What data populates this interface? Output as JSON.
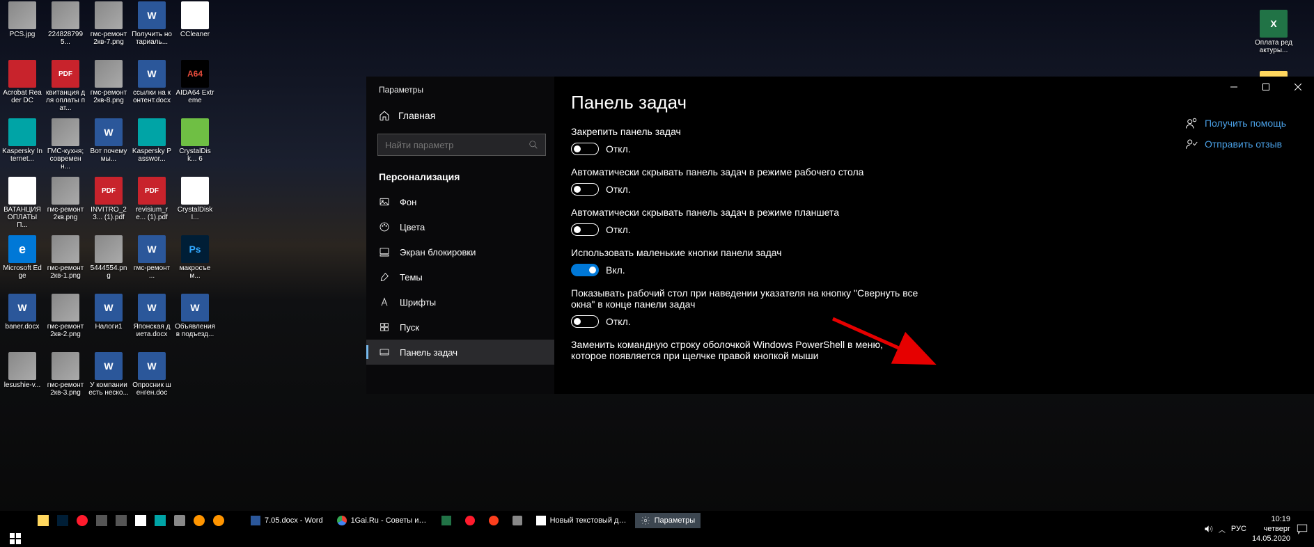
{
  "desktop_icons": [
    {
      "label": "PCS.jpg",
      "type": "img",
      "col": 0,
      "row": 0
    },
    {
      "label": "Acrobat Reader DC",
      "type": "adobe",
      "col": 0,
      "row": 1
    },
    {
      "label": "Kaspersky Internet...",
      "type": "teal",
      "col": 0,
      "row": 2
    },
    {
      "label": "ВАТАНЦИЯ ОПЛАТЫ П...",
      "type": "txt",
      "col": 0,
      "row": 3
    },
    {
      "label": "Microsoft Edge",
      "type": "edge",
      "col": 0,
      "row": 4
    },
    {
      "label": "baner.docx",
      "type": "word",
      "col": 0,
      "row": 5
    },
    {
      "label": "lesushie-v...",
      "type": "img",
      "col": 0,
      "row": 6
    },
    {
      "label": "2248287995...",
      "type": "img",
      "col": 1,
      "row": 0
    },
    {
      "label": "квитанция для оплаты пат...",
      "type": "pdf",
      "col": 1,
      "row": 1
    },
    {
      "label": "ГМС-кухня; современн...",
      "type": "img",
      "col": 1,
      "row": 2
    },
    {
      "label": "гмс-ремонт 2кв.png",
      "type": "img",
      "col": 1,
      "row": 3
    },
    {
      "label": "гмс-ремонт 2кв-1.png",
      "type": "img",
      "col": 1,
      "row": 4
    },
    {
      "label": "гмс-ремонт 2кв-2.png",
      "type": "img",
      "col": 1,
      "row": 5
    },
    {
      "label": "гмс-ремонт 2кв-3.png",
      "type": "img",
      "col": 1,
      "row": 6
    },
    {
      "label": "гмс-ремонт 2кв-7.png",
      "type": "img",
      "col": 2,
      "row": 0
    },
    {
      "label": "гмс-ремонт 2кв-8.png",
      "type": "img",
      "col": 2,
      "row": 1
    },
    {
      "label": "Вот почему мы...",
      "type": "word",
      "col": 2,
      "row": 2
    },
    {
      "label": "INVITRO_23... (1).pdf",
      "type": "pdf",
      "col": 2,
      "row": 3
    },
    {
      "label": "5444554.png",
      "type": "img",
      "col": 2,
      "row": 4
    },
    {
      "label": "Налоги1",
      "type": "word",
      "col": 2,
      "row": 5
    },
    {
      "label": "У компании есть неско...",
      "type": "word",
      "col": 2,
      "row": 6
    },
    {
      "label": "Получить нотариаль...",
      "type": "word",
      "col": 3,
      "row": 0
    },
    {
      "label": "ссылки на контент.docx",
      "type": "word",
      "col": 3,
      "row": 1
    },
    {
      "label": "Kaspersky Passwor...",
      "type": "teal",
      "col": 3,
      "row": 2
    },
    {
      "label": "revisium_re... (1).pdf",
      "type": "pdf",
      "col": 3,
      "row": 3
    },
    {
      "label": "гмс-ремонт ...",
      "type": "word",
      "col": 3,
      "row": 4
    },
    {
      "label": "Японская диета.docx",
      "type": "word",
      "col": 3,
      "row": 5
    },
    {
      "label": "Опросник шенген.doc",
      "type": "word",
      "col": 3,
      "row": 6
    },
    {
      "label": "CCleaner",
      "type": "cc",
      "col": 4,
      "row": 0
    },
    {
      "label": "AIDA64 Extreme",
      "type": "a64",
      "col": 4,
      "row": 1
    },
    {
      "label": "CrystalDisk... 6",
      "type": "cd",
      "col": 4,
      "row": 2
    },
    {
      "label": "CrystalDiskI...",
      "type": "cdi",
      "col": 4,
      "row": 3
    },
    {
      "label": "макросъем...",
      "type": "ps",
      "col": 4,
      "row": 4
    },
    {
      "label": "Объявления в подъезд...",
      "type": "word",
      "col": 4,
      "row": 5
    }
  ],
  "right_desktop_icons": [
    {
      "label": "Оплата редактуры...",
      "type": "excel"
    }
  ],
  "settings": {
    "window_title": "Параметры",
    "nav": {
      "home": "Главная",
      "search_placeholder": "Найти параметр",
      "section": "Персонализация",
      "items": [
        {
          "label": "Фон",
          "icon": "image"
        },
        {
          "label": "Цвета",
          "icon": "palette"
        },
        {
          "label": "Экран блокировки",
          "icon": "lock"
        },
        {
          "label": "Темы",
          "icon": "brush"
        },
        {
          "label": "Шрифты",
          "icon": "font"
        },
        {
          "label": "Пуск",
          "icon": "start"
        },
        {
          "label": "Панель задач",
          "icon": "taskbar",
          "active": true
        }
      ]
    },
    "page": {
      "title": "Панель задач",
      "toggles": [
        {
          "label": "Закрепить панель задач",
          "state": "Откл.",
          "on": false
        },
        {
          "label": "Автоматически скрывать панель задач в режиме рабочего стола",
          "state": "Откл.",
          "on": false
        },
        {
          "label": "Автоматически скрывать панель задач в режиме планшета",
          "state": "Откл.",
          "on": false
        },
        {
          "label": "Использовать маленькие кнопки панели задач",
          "state": "Вкл.",
          "on": true
        },
        {
          "label": "Показывать рабочий стол при наведении указателя на кнопку \"Свернуть все окна\" в конце панели задач",
          "state": "Откл.",
          "on": false
        }
      ],
      "footer_text": "Заменить командную строку оболочкой Windows PowerShell в меню, которое появляется при щелчке правой кнопкой мыши"
    },
    "help": [
      {
        "label": "Получить помощь",
        "icon": "help"
      },
      {
        "label": "Отправить отзыв",
        "icon": "feedback"
      }
    ]
  },
  "taskbar": {
    "pinned": [
      "explorer",
      "ps",
      "opera",
      "bar",
      "bar",
      "cc",
      "k",
      "camera",
      "fx",
      "fx"
    ],
    "tasks": [
      {
        "icon": "word",
        "label": "7.05.docx - Word"
      },
      {
        "icon": "chrome",
        "label": "1Gai.Ru - Советы и т..."
      },
      {
        "icon": "excel",
        "label": ""
      },
      {
        "icon": "opera",
        "label": ""
      },
      {
        "icon": "ya",
        "label": ""
      },
      {
        "icon": "camera",
        "label": ""
      },
      {
        "icon": "txt",
        "label": "Новый текстовый до..."
      },
      {
        "icon": "gear",
        "label": "Параметры",
        "active": true
      }
    ],
    "tray": {
      "lang": "РУС",
      "time": "10:19",
      "day": "четверг",
      "date": "14.05.2020"
    }
  }
}
